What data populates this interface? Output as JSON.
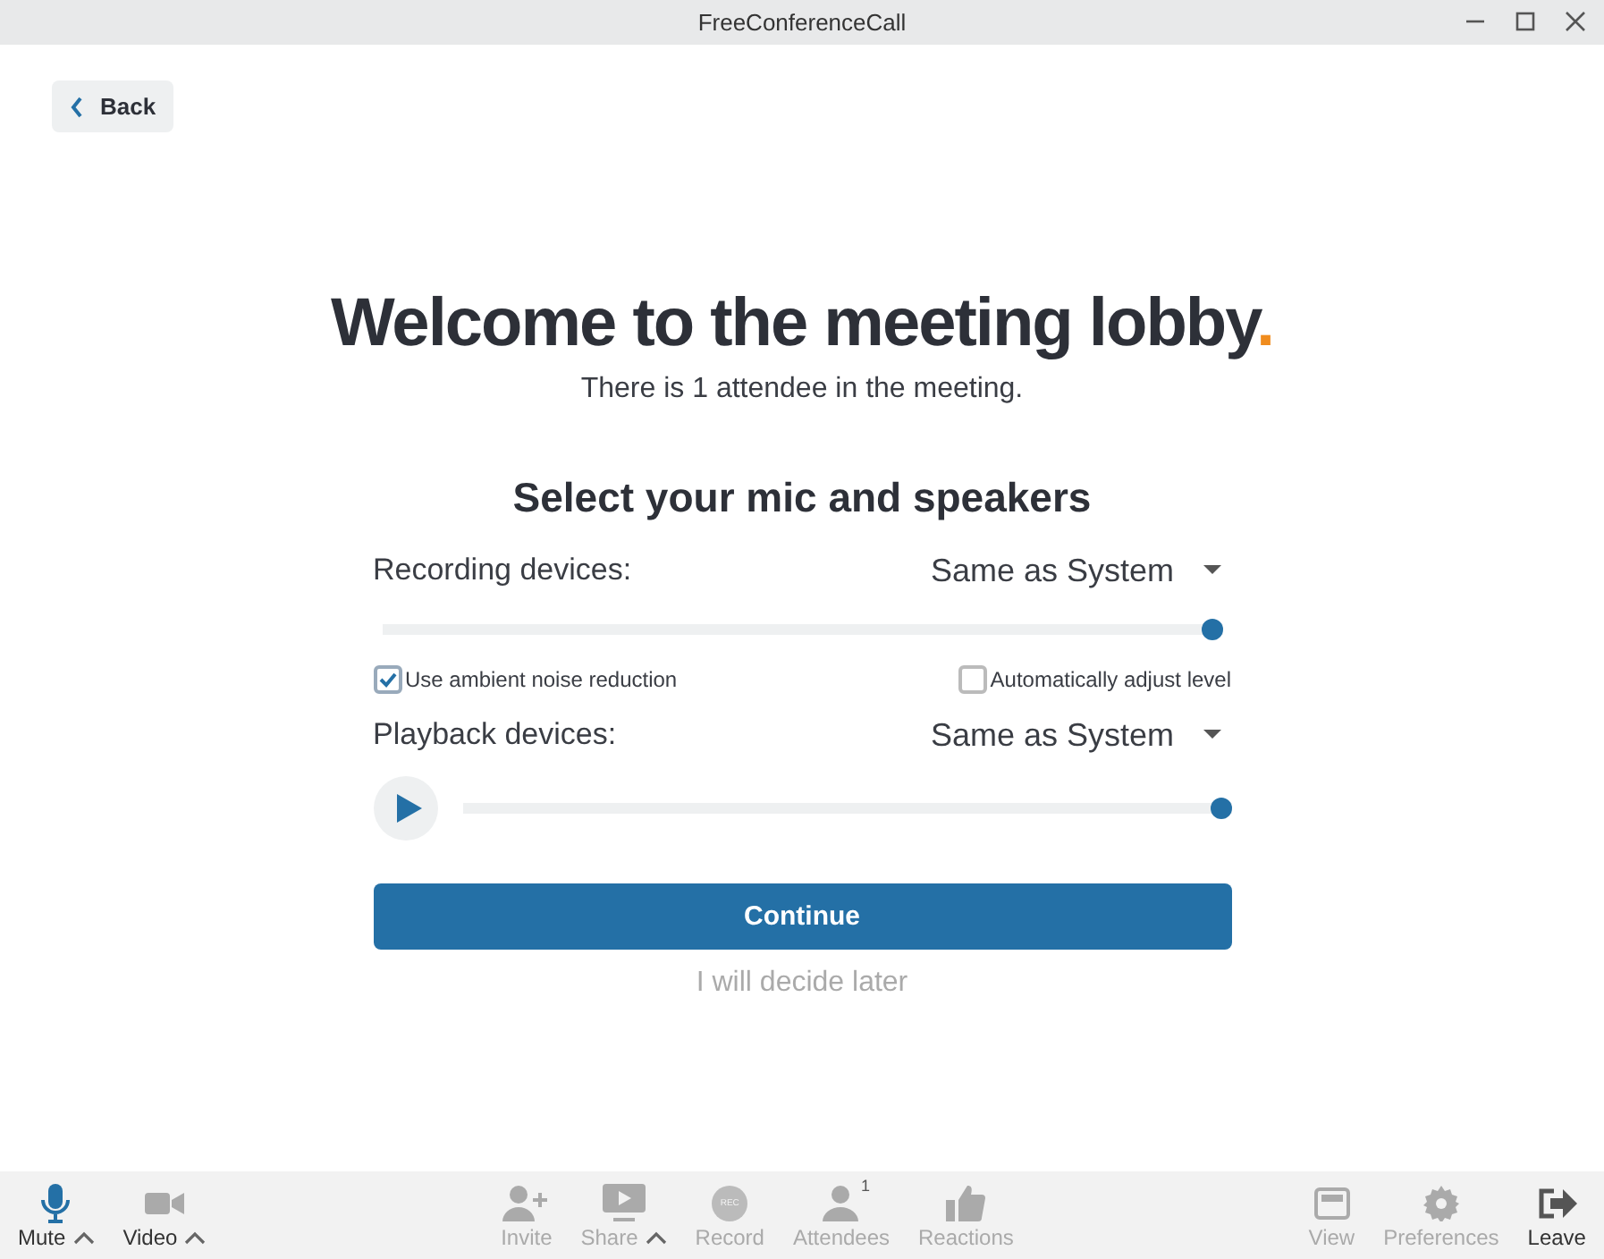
{
  "window": {
    "title": "FreeConferenceCall"
  },
  "back_button": {
    "label": "Back"
  },
  "heading": {
    "title": "Welcome to the meeting lobby",
    "title_mark": ".",
    "subtitle": "There is 1 attendee in the meeting."
  },
  "devices": {
    "title": "Select your mic and speakers",
    "recording": {
      "label": "Recording devices:",
      "value": "Same as System",
      "level": 1
    },
    "options": [
      {
        "label": "Use ambient noise reduction",
        "checked": true
      },
      {
        "label": "Automatically adjust level",
        "checked": false
      }
    ],
    "playback": {
      "label": "Playback devices:",
      "value": "Same as System",
      "level": 1
    }
  },
  "continue_button": {
    "label": "Continue"
  },
  "later_link": {
    "label": "I will decide later"
  },
  "toolbar": {
    "left": [
      {
        "kind": "mic",
        "label": "Mute",
        "active": true,
        "disabled": false,
        "caret": true
      },
      {
        "kind": "video",
        "label": "Video",
        "active": false,
        "disabled": false,
        "caret": true
      }
    ],
    "center": [
      {
        "kind": "invite",
        "label": "Invite",
        "active": false,
        "disabled": true,
        "caret": false
      },
      {
        "kind": "share",
        "label": "Share",
        "active": false,
        "disabled": true,
        "caret": true
      },
      {
        "kind": "record",
        "label": "Record",
        "icon_text": "REC",
        "active": false,
        "disabled": true,
        "caret": false
      },
      {
        "kind": "attendees",
        "label": "Attendees",
        "badge": "1",
        "active": false,
        "disabled": true,
        "caret": false
      },
      {
        "kind": "reactions",
        "label": "Reactions",
        "active": false,
        "disabled": true,
        "caret": false
      }
    ],
    "right": [
      {
        "kind": "view",
        "label": "View",
        "active": false,
        "disabled": true,
        "caret": false
      },
      {
        "kind": "preferences",
        "label": "Preferences",
        "active": false,
        "disabled": true,
        "caret": false
      },
      {
        "kind": "leave",
        "label": "Leave",
        "active": false,
        "disabled": false,
        "caret": false
      }
    ]
  }
}
